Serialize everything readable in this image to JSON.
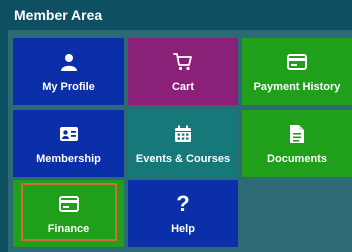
{
  "header": {
    "title": "Member Area"
  },
  "tiles": [
    {
      "key": "my_profile",
      "label": "My Profile",
      "icon": "user-icon",
      "color": "#0b2fa8"
    },
    {
      "key": "cart",
      "label": "Cart",
      "icon": "cart-icon",
      "color": "#8b2078"
    },
    {
      "key": "payment_history",
      "label": "Payment History",
      "icon": "credit-card-icon",
      "color": "#1f9f1a"
    },
    {
      "key": "membership",
      "label": "Membership",
      "icon": "id-card-icon",
      "color": "#0b2fa8"
    },
    {
      "key": "events_courses",
      "label": "Events & Courses",
      "icon": "calendar-icon",
      "color": "#17787a"
    },
    {
      "key": "documents",
      "label": "Documents",
      "icon": "document-icon",
      "color": "#1f9f1a"
    },
    {
      "key": "finance",
      "label": "Finance",
      "icon": "credit-card-icon",
      "color": "#1f9f1a",
      "highlighted": true
    },
    {
      "key": "help",
      "label": "Help",
      "icon": "question-icon",
      "color": "#0b2fa8"
    }
  ]
}
